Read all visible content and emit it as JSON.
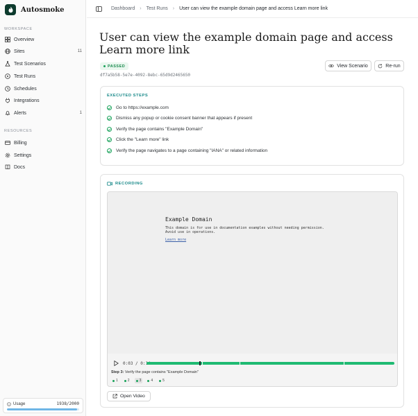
{
  "app": {
    "name": "Autosmoke"
  },
  "sidebar": {
    "workspace_label": "WORKSPACE",
    "workspace_items": [
      {
        "label": "Overview",
        "icon": "grid-icon"
      },
      {
        "label": "Sites",
        "icon": "globe-icon",
        "count": "11"
      },
      {
        "label": "Test Scenarios",
        "icon": "flask-icon"
      },
      {
        "label": "Test Runs",
        "icon": "play-circle-icon"
      },
      {
        "label": "Schedules",
        "icon": "clock-icon"
      },
      {
        "label": "Integrations",
        "icon": "plug-icon"
      },
      {
        "label": "Alerts",
        "icon": "bell-icon",
        "count": "1"
      }
    ],
    "resources_label": "RESOURCES",
    "resource_items": [
      {
        "label": "Billing",
        "icon": "card-icon"
      },
      {
        "label": "Settings",
        "icon": "gear-icon"
      },
      {
        "label": "Docs",
        "icon": "book-icon"
      }
    ],
    "usage": {
      "label": "Usage",
      "value": "1938/2000",
      "fraction": 0.969
    }
  },
  "breadcrumb": {
    "items": [
      "Dashboard",
      "Test Runs"
    ],
    "current": "User can view the example domain page and access Learn more link"
  },
  "run": {
    "title": "User can view the example domain page and access Learn more link",
    "status": "PASSED",
    "id": "df7a5b58-5e7e-4092-8ebc-65d9d2465650",
    "view_scenario_label": "View Scenario",
    "rerun_label": "Re-run"
  },
  "steps_card": {
    "heading": "EXECUTED STEPS",
    "steps": [
      "Go to https://example.com",
      "Dismiss any popup or cookie consent banner that appears if present",
      "Verify the page contains \"Example Domain\"",
      "Click the \"Learn more\" link",
      "Verify the page navigates to a page containing \"IANA\" or related information"
    ]
  },
  "recording": {
    "heading": "RECORDING",
    "page": {
      "title": "Example Domain",
      "body_line1": "This domain is for use in documentation examples without needing permission.",
      "body_line2": "Avoid use in operations.",
      "link": "Learn more"
    },
    "time": "0:03 / 0:14",
    "progress": 0.214,
    "step_label": "Step 3:",
    "step_text": "Verify the page contains \"Example Domain\"",
    "markers": [
      "1",
      "2",
      "3",
      "4",
      "5"
    ],
    "active_marker": "3",
    "open_video_label": "Open Video"
  },
  "colors": {
    "accent": "#1aa35b",
    "teal": "#1a8a8a",
    "brand": "#0d3b2e"
  }
}
